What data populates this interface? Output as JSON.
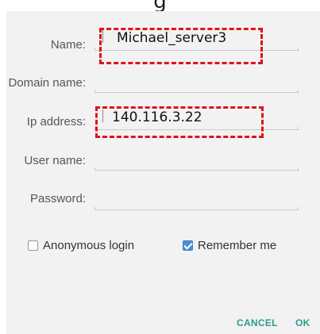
{
  "dialog": {
    "fields": [
      {
        "label": "Name:",
        "value": "Michael_server3"
      },
      {
        "label": "Domain name:",
        "value": ""
      },
      {
        "label": "Ip address:",
        "value": "140.116.3.22"
      },
      {
        "label": "User name:",
        "value": ""
      },
      {
        "label": "Password:",
        "value": ""
      }
    ],
    "anonymous_login": {
      "label": "Anonymous login",
      "checked": false
    },
    "remember_me": {
      "label": "Remember me",
      "checked": true
    },
    "actions": {
      "cancel": "CANCEL",
      "ok": "OK"
    }
  },
  "colors": {
    "accent": "#2a9d8f",
    "checkbox": "#4a90d9",
    "highlight": "#e0131a",
    "dialog_bg": "#f2f2f2"
  }
}
